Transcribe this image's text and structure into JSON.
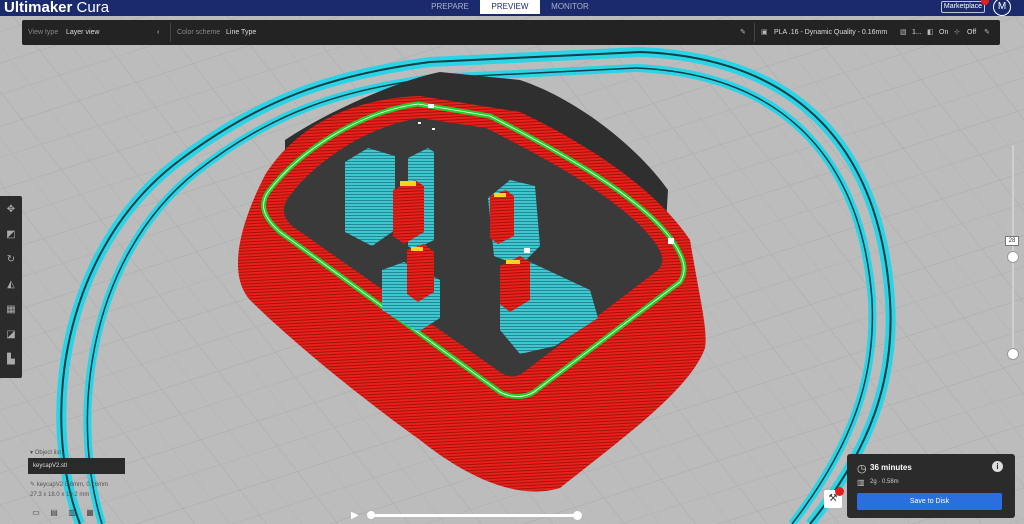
{
  "app": {
    "title_bold": "Ultimaker",
    "title_rest": " Cura"
  },
  "stages": [
    {
      "label": "PREPARE",
      "active": false
    },
    {
      "label": "PREVIEW",
      "active": true
    },
    {
      "label": "MONITOR",
      "active": false
    }
  ],
  "header": {
    "marketplace_label": "Marketplace",
    "account_initial": "M"
  },
  "toolbar": {
    "view_type_label": "View type",
    "view_type_value": "Layer view",
    "color_scheme_label": "Color scheme",
    "color_scheme_value": "Line Type",
    "profile": "PLA .16 - Dynamic Quality - 0.16mm",
    "infill": "1...",
    "support": "On",
    "adhesion": "Off"
  },
  "layer_slider": {
    "current_layer": "28"
  },
  "object_list": {
    "header": "Object list",
    "items": [
      "keycapV2.stl"
    ],
    "info_name": "keycapV2 0.6mm, 0.16mm",
    "info_dims": "27.3 x 18.0 x 10.2 mm"
  },
  "job": {
    "print_time": "36 minutes",
    "material": "2g · 0.58m",
    "save_label": "Save to Disk"
  },
  "colors": {
    "header_bg": "#1a2a6c",
    "accent_blue": "#2a6ee0",
    "wall_red": "#e8211b",
    "support_cyan": "#3cc9d8",
    "outer_wall_green": "#22d12a",
    "build_plate_grey": "#b9b9b9"
  },
  "icons": {
    "tools": [
      "move-icon",
      "scale-icon",
      "rotate-icon",
      "mirror-icon",
      "per-model-settings-icon",
      "support-blocker-icon",
      "layer-icon"
    ]
  }
}
